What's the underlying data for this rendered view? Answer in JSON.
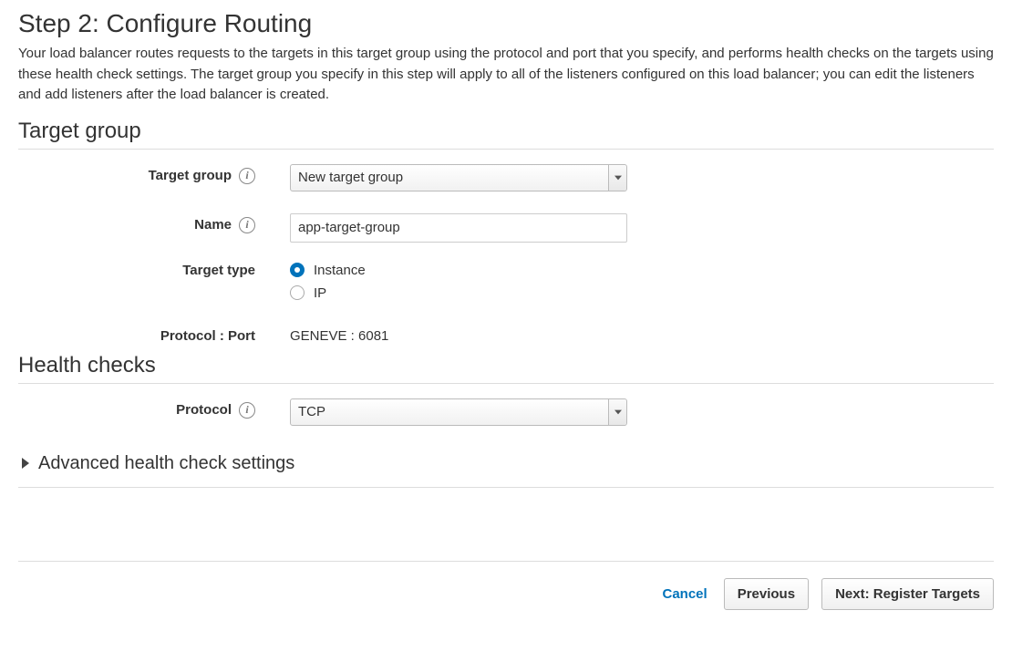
{
  "page": {
    "title": "Step 2: Configure Routing",
    "description": "Your load balancer routes requests to the targets in this target group using the protocol and port that you specify, and performs health checks on the targets using these health check settings. The target group you specify in this step will apply to all of the listeners configured on this load balancer; you can edit the listeners and add listeners after the load balancer is created."
  },
  "sections": {
    "target_group": {
      "heading": "Target group",
      "fields": {
        "target_group_label": "Target group",
        "target_group_value": "New target group",
        "name_label": "Name",
        "name_value": "app-target-group",
        "target_type_label": "Target type",
        "target_type_options": {
          "instance": "Instance",
          "ip": "IP"
        },
        "protocol_port_label": "Protocol : Port",
        "protocol_port_value": "GENEVE : 6081"
      }
    },
    "health_checks": {
      "heading": "Health checks",
      "fields": {
        "protocol_label": "Protocol",
        "protocol_value": "TCP"
      },
      "advanced_label": "Advanced health check settings"
    }
  },
  "footer": {
    "cancel": "Cancel",
    "previous": "Previous",
    "next": "Next: Register Targets"
  }
}
